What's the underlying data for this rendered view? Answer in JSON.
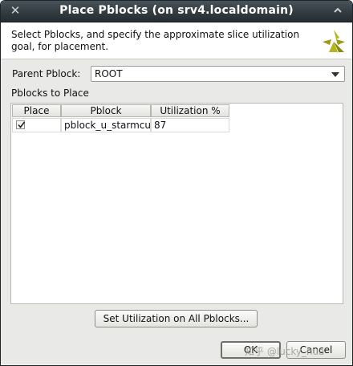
{
  "window": {
    "title": "Place Pblocks (on srv4.localdomain)",
    "close_icon": "close-icon",
    "maximize_icon": "maximize-icon"
  },
  "header": {
    "description": "Select Pblocks, and specify the approximate slice utilization goal, for placement.",
    "logo_icon": "xilinx-logo-icon"
  },
  "parent_pblock": {
    "label": "Parent Pblock:",
    "selected": "ROOT"
  },
  "pblocks_section": {
    "label": "Pblocks to Place",
    "columns": [
      "Place",
      "Pblock",
      "Utilization %"
    ],
    "rows": [
      {
        "place": true,
        "pblock": "pblock_u_starmcu",
        "utilization": "87"
      }
    ]
  },
  "buttons": {
    "set_utilization": "Set Utilization on All Pblocks...",
    "ok": "OK",
    "cancel": "Cancel"
  },
  "watermark": "知乎 @lucky_hua"
}
